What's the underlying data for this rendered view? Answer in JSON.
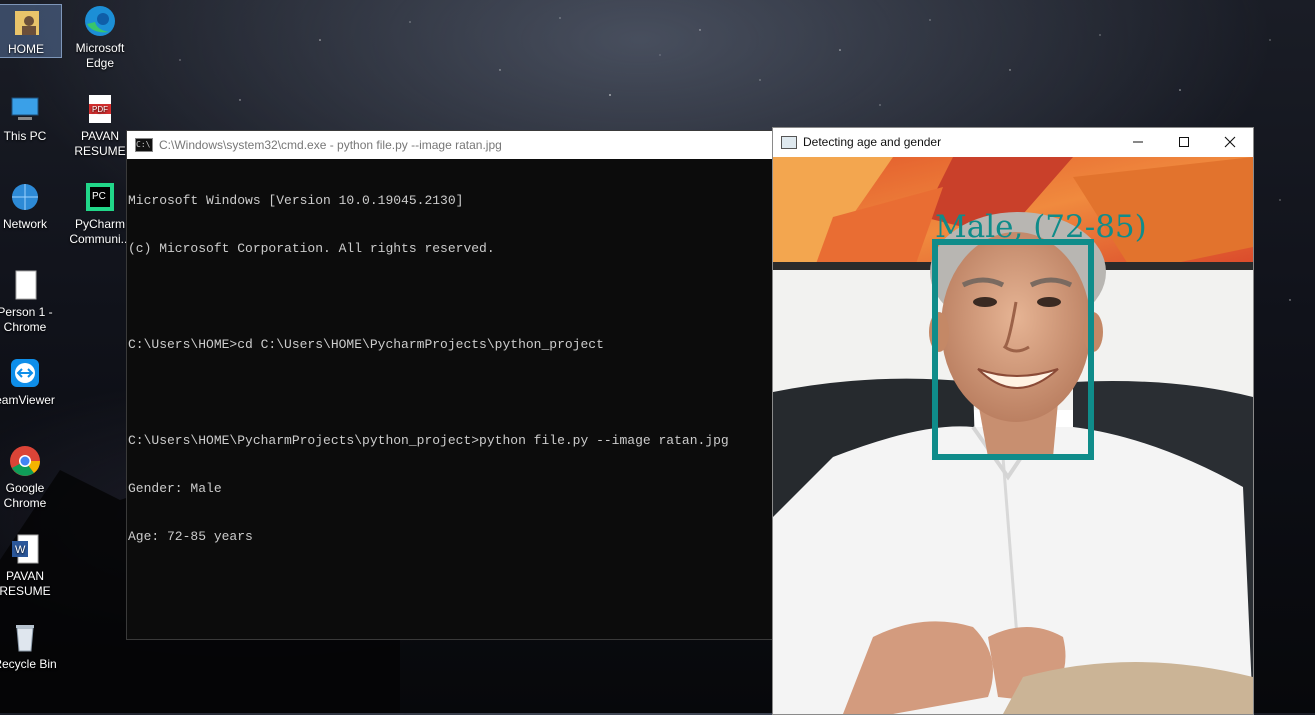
{
  "desktop": {
    "icons": [
      {
        "label_1": "HOME",
        "label_2": "",
        "icon": "user-folder-icon"
      },
      {
        "label_1": "Microsoft",
        "label_2": "Edge",
        "icon": "edge-icon"
      },
      {
        "label_1": "This PC",
        "label_2": "",
        "icon": "computer-icon"
      },
      {
        "label_1": "PAVAN",
        "label_2": "RESUME",
        "icon": "pdf-icon"
      },
      {
        "label_1": "Network",
        "label_2": "",
        "icon": "network-icon"
      },
      {
        "label_1": "PyCharm",
        "label_2": "Communi...",
        "icon": "pycharm-icon"
      },
      {
        "label_1": "Person 1 -",
        "label_2": "Chrome",
        "icon": "shortcut-file-icon"
      },
      {
        "label_1": "eamViewer",
        "label_2": "",
        "icon": "teamviewer-icon"
      },
      {
        "label_1": "Google",
        "label_2": "Chrome",
        "icon": "chrome-icon"
      },
      {
        "label_1": "PAVAN",
        "label_2": "RESUME",
        "icon": "word-icon"
      },
      {
        "label_1": "Recycle Bin",
        "label_2": "",
        "icon": "recycle-bin-icon"
      }
    ]
  },
  "cmd_window": {
    "title": "C:\\Windows\\system32\\cmd.exe - python  file.py --image ratan.jpg",
    "lines": [
      "Microsoft Windows [Version 10.0.19045.2130]",
      "(c) Microsoft Corporation. All rights reserved.",
      "",
      "C:\\Users\\HOME>cd C:\\Users\\HOME\\PycharmProjects\\python_project",
      "",
      "C:\\Users\\HOME\\PycharmProjects\\python_project>python file.py --image ratan.jpg",
      "Gender: Male",
      "Age: 72-85 years"
    ]
  },
  "cv_window": {
    "title": "Detecting age and gender",
    "detection_label": "Male, (72-85)",
    "box_color": "#0f8c8a",
    "controls": {
      "minimize": "minimize-icon",
      "maximize": "maximize-icon",
      "close": "close-icon"
    }
  }
}
